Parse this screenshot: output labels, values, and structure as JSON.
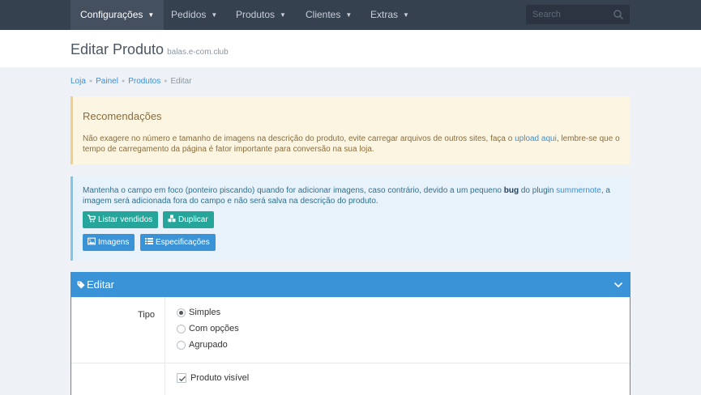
{
  "nav": {
    "items": [
      {
        "label": "Configurações",
        "active": true
      },
      {
        "label": "Pedidos"
      },
      {
        "label": "Produtos"
      },
      {
        "label": "Clientes"
      },
      {
        "label": "Extras"
      }
    ],
    "search_placeholder": "Search"
  },
  "header": {
    "title": "Editar Produto",
    "subtitle": "balas.e-com.club"
  },
  "breadcrumb": [
    "Loja",
    "Painel",
    "Produtos",
    "Editar"
  ],
  "recommendation": {
    "title": "Recomendações",
    "text_before_link": "Não exagere no número e tamanho de imagens na descrição do produto, evite carregar arquivos de outros sites, faça o ",
    "link": "upload aqui",
    "text_after_link": ", lembre-se que o tempo de carregamento da página é fator importante para conversão na sua loja."
  },
  "info": {
    "text_before_bold": "Mantenha o campo em foco (ponteiro piscando) quando for adicionar imagens, caso contrário, devido a um pequeno ",
    "bold": "bug",
    "text_middle": " do plugin ",
    "link": "summernote",
    "text_after_link": ", a imagem será adicionada fora do campo e não será salva na descrição do produto.",
    "buttons": {
      "list_sold": "Listar vendidos",
      "duplicate": "Duplicar",
      "images": "Imagens",
      "specs": "Especificações"
    }
  },
  "panel": {
    "title": "Editar",
    "tipo_label": "Tipo",
    "tipo_options": [
      "Simples",
      "Com opções",
      "Agrupado"
    ],
    "tipo_selected": "Simples",
    "visible_label": "Produto visível",
    "visible_checked": true
  },
  "colors": {
    "nav_bg": "#364150",
    "accent_blue": "#3a93d6",
    "teal": "#26a69a",
    "warning_bg": "#fcf5e1",
    "info_bg": "#e7f2fa"
  }
}
